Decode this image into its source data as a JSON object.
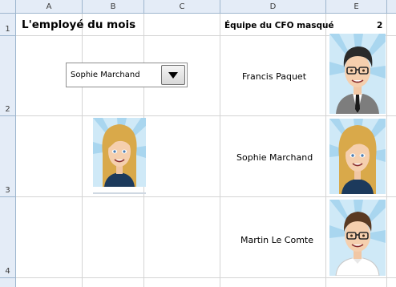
{
  "sheet": {
    "columns": [
      "A",
      "B",
      "C",
      "D",
      "E"
    ],
    "rows": [
      "1",
      "2",
      "3",
      "4"
    ]
  },
  "cells": {
    "a1_title": "L'employé du mois",
    "d1_header": "Équipe du CFO masqué",
    "e1_value": "2"
  },
  "dropdown": {
    "selected": "Sophie Marchand"
  },
  "team": [
    {
      "name": "Francis Paquet",
      "avatar": "male-glasses-suit-avatar"
    },
    {
      "name": "Sophie Marchand",
      "avatar": "female-blonde-avatar"
    },
    {
      "name": "Martin Le Comte",
      "avatar": "male-glasses-shirt-avatar"
    }
  ],
  "selected_employee": {
    "avatar": "female-blonde-avatar"
  },
  "colors": {
    "header_bg": "#e4ecf7",
    "gridline": "#d4d4d4",
    "sunburst": "#cfe9f7"
  }
}
